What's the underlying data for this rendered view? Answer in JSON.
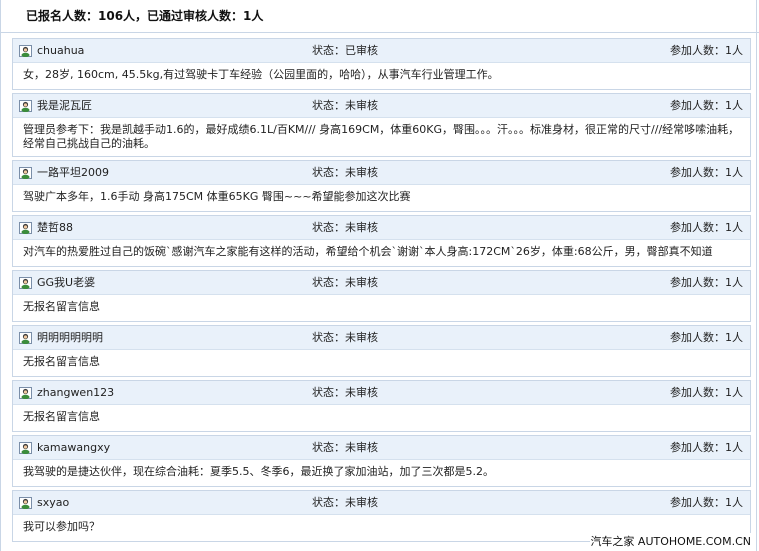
{
  "summary": "已报名人数：106人，已通过审核人数：1人",
  "entries": [
    {
      "name": "chuahua",
      "status": "状态：已审核",
      "count": "参加人数：1人",
      "message": "女，28岁, 160cm, 45.5kg,有过驾驶卡丁车经验（公园里面的，哈哈），从事汽车行业管理工作。"
    },
    {
      "name": "我是泥瓦匠",
      "status": "状态：未审核",
      "count": "参加人数：1人",
      "message": "管理员参考下：我是凯越手动1.6的，最好成绩6.1L/百KM/// 身高169CM，体重60KG，臀围。。。汗。。。标准身材，很正常的尺寸///经常哆嗦油耗，经常自己挑战自己的油耗。"
    },
    {
      "name": "一路平坦2009",
      "status": "状态：未审核",
      "count": "参加人数：1人",
      "message": "驾驶广本多年，1.6手动 身高175CM 体重65KG 臀围~~~希望能参加这次比赛"
    },
    {
      "name": "楚哲88",
      "status": "状态：未审核",
      "count": "参加人数：1人",
      "message": "对汽车的热爱胜过自己的饭碗`感谢汽车之家能有这样的活动，希望给个机会`谢谢`本人身高:172CM`26岁，体重:68公斤，男，臀部真不知道"
    },
    {
      "name": "GG我U老婆",
      "status": "状态：未审核",
      "count": "参加人数：1人",
      "message": "无报名留言信息"
    },
    {
      "name": "明明明明明明",
      "status": "状态：未审核",
      "count": "参加人数：1人",
      "message": "无报名留言信息"
    },
    {
      "name": "zhangwen123",
      "status": "状态：未审核",
      "count": "参加人数：1人",
      "message": "无报名留言信息"
    },
    {
      "name": "kamawangxy",
      "status": "状态：未审核",
      "count": "参加人数：1人",
      "message": "我驾驶的是捷达伙伴，现在综合油耗：夏季5.5、冬季6，最近换了家加油站，加了三次都是5.2。"
    },
    {
      "name": "sxyao",
      "status": "状态：未审核",
      "count": "参加人数：1人",
      "message": "我可以参加吗？"
    }
  ],
  "watermark": "汽车之家 AUTOHOME.COM.CN",
  "icons": {
    "avatar": "user-avatar-icon"
  },
  "colors": {
    "header_bg": "#e9f1fa",
    "border": "#c9d6e6"
  }
}
